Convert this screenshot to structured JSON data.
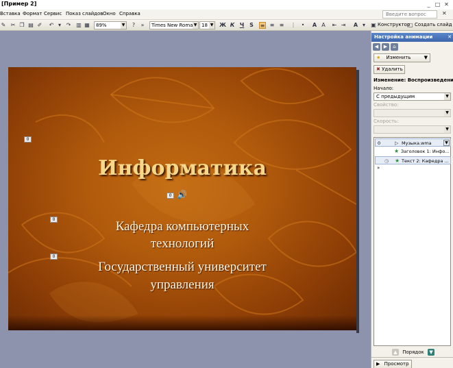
{
  "window": {
    "title": "[Пример 2]"
  },
  "menu": {
    "items": [
      "Вставка",
      "Формат",
      "Сервис",
      "Показ слайдов",
      "Окно",
      "Справка"
    ],
    "ask_placeholder": "Введите вопрос",
    "close_glyph": "✕"
  },
  "toolbar": {
    "zoom": "89%",
    "font": "Times New Roman",
    "font_size": "18",
    "bold": "Ж",
    "italic": "К",
    "underline": "Ч",
    "shadow": "S",
    "designer": "Конструктор",
    "new_slide": "Создать слайд"
  },
  "slide": {
    "title": "Информатика",
    "subtitle_line1": "Кафедра компьютерных",
    "subtitle_line2": "технологий",
    "subtitle_line3": "Государственный университет",
    "subtitle_line4": "управления",
    "tag_label": "0",
    "colors": {
      "background": "#b05a0c",
      "title": "#f5d88a"
    }
  },
  "task_pane": {
    "title": "Настройка анимации",
    "close_glyph": "✕",
    "change_button": "Изменить",
    "delete_button": "Удалить",
    "section_title": "Изменение: Воспроизведение",
    "start_label": "Начало:",
    "start_value": "С предыдущим",
    "property_label": "Свойство:",
    "speed_label": "Скорость:",
    "list": [
      {
        "num": "0",
        "label": "Музыка.wma"
      },
      {
        "num": "",
        "label": "Заголовок 1: Инфо..."
      },
      {
        "num": "",
        "label": "Текст 2: Кафедра ..."
      }
    ],
    "order_label": "Порядок",
    "preview_button": "Просмотр"
  }
}
